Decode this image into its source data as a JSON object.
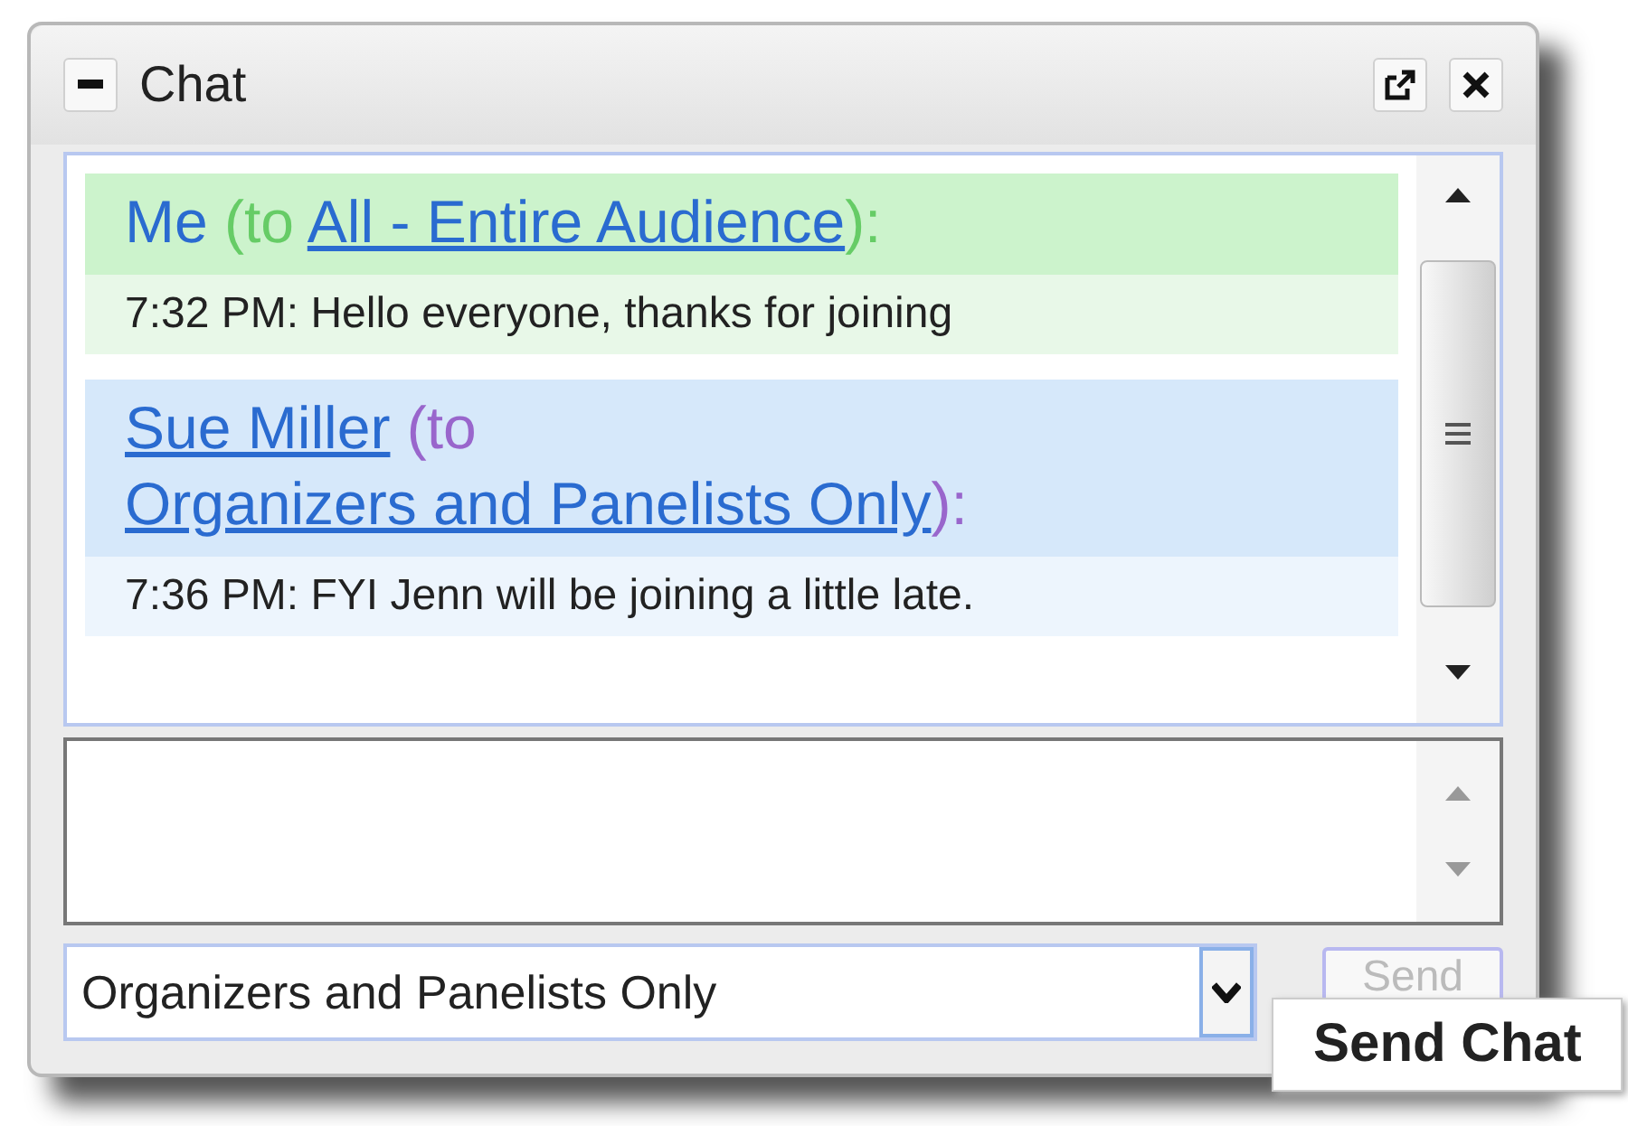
{
  "window": {
    "title": "Chat"
  },
  "messages": [
    {
      "kind": "sent",
      "sender": "Me",
      "to_prefix": "(to",
      "recipient": "All - Entire Audience",
      "suffix": "):",
      "body": "7:32 PM: Hello everyone, thanks for joining"
    },
    {
      "kind": "received",
      "sender": "Sue Miller",
      "to_prefix": "(to",
      "recipient": "Organizers and Panelists Only",
      "suffix": "):",
      "body": "7:36 PM: FYI Jenn will be joining a little late."
    }
  ],
  "recipient_select": {
    "value": "Organizers and Panelists Only"
  },
  "send_button": {
    "label": "Send",
    "disabled": true
  },
  "tooltip": {
    "text": "Send Chat"
  }
}
